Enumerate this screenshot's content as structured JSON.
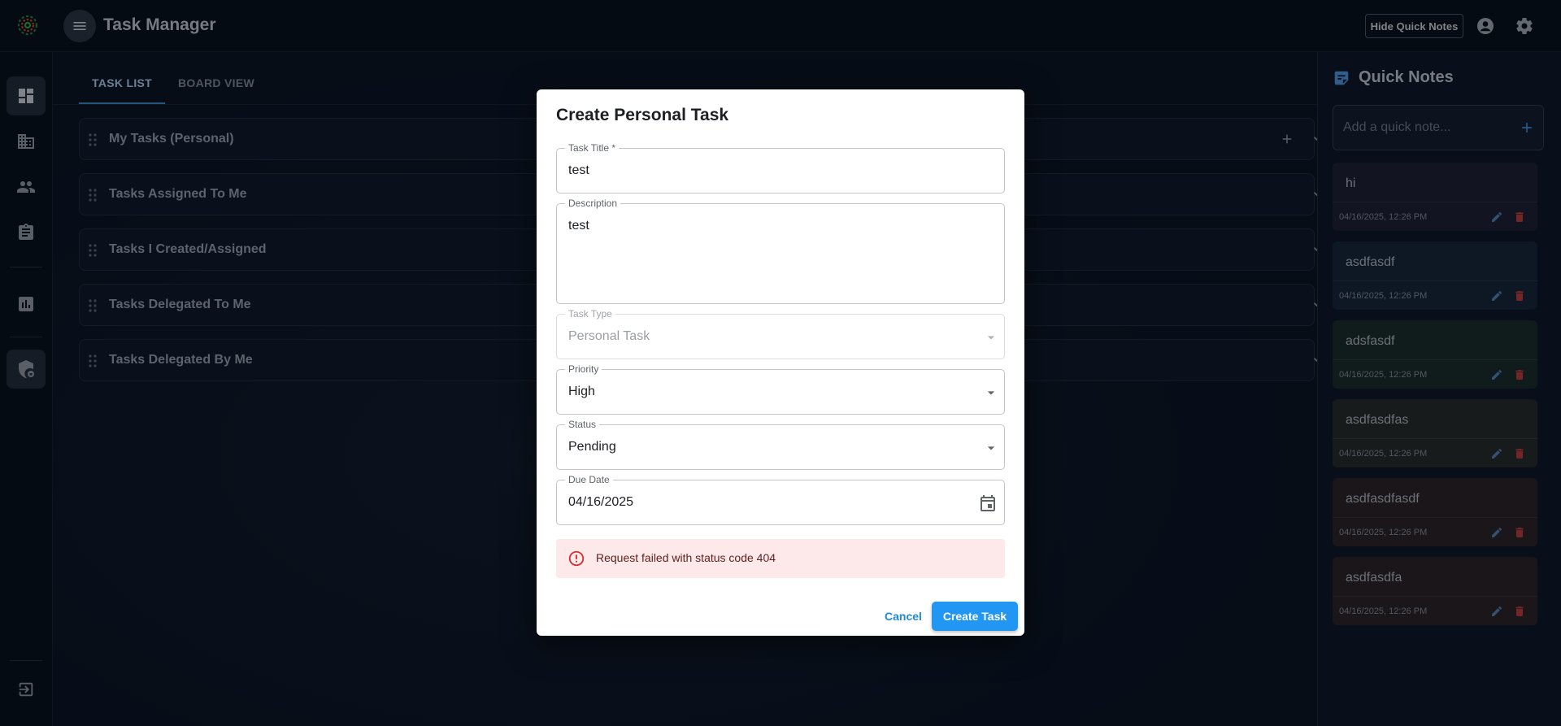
{
  "app": {
    "title": "Task Manager",
    "hide_notes_label": "Hide Quick Notes"
  },
  "tabs": [
    {
      "label": "TASK LIST",
      "active": true
    },
    {
      "label": "BOARD VIEW",
      "active": false
    }
  ],
  "sections": [
    {
      "title": "My Tasks (Personal)"
    },
    {
      "title": "Tasks Assigned To Me"
    },
    {
      "title": "Tasks I Created/Assigned"
    },
    {
      "title": "Tasks Delegated To Me"
    },
    {
      "title": "Tasks Delegated By Me"
    }
  ],
  "quick_notes": {
    "title": "Quick Notes",
    "input_placeholder": "Add a quick note...",
    "notes": [
      {
        "text": "hi",
        "time": "04/16/2025, 12:26 PM",
        "color": "#1c2034"
      },
      {
        "text": "asdfasdf",
        "time": "04/16/2025, 12:26 PM",
        "color": "#16253a"
      },
      {
        "text": "adsfasdf",
        "time": "04/16/2025, 12:26 PM",
        "color": "#1a2a2a"
      },
      {
        "text": "asdfasdfas",
        "time": "04/16/2025, 12:26 PM",
        "color": "#262a2c"
      },
      {
        "text": "asdfasdfasdf",
        "time": "04/16/2025, 12:26 PM",
        "color": "#2a2228"
      },
      {
        "text": "asdfasdfa",
        "time": "04/16/2025, 12:26 PM",
        "color": "#2a2228"
      }
    ]
  },
  "dialog": {
    "title": "Create Personal Task",
    "fields": {
      "task_title": {
        "label": "Task Title *",
        "value": "test"
      },
      "description": {
        "label": "Description",
        "value": "test"
      },
      "task_type": {
        "label": "Task Type",
        "value": "Personal Task"
      },
      "priority": {
        "label": "Priority",
        "value": "High"
      },
      "status": {
        "label": "Status",
        "value": "Pending"
      },
      "due_date": {
        "label": "Due Date",
        "value": "04/16/2025"
      }
    },
    "error": "Request failed with status code 404",
    "cancel_label": "Cancel",
    "create_label": "Create Task"
  },
  "colors": {
    "accent": "#2196f3",
    "error_bg": "#fde9e9",
    "error_icon": "#d32f2f",
    "delete_icon": "#b33a3a",
    "edit_icon": "#4c7fb3"
  }
}
